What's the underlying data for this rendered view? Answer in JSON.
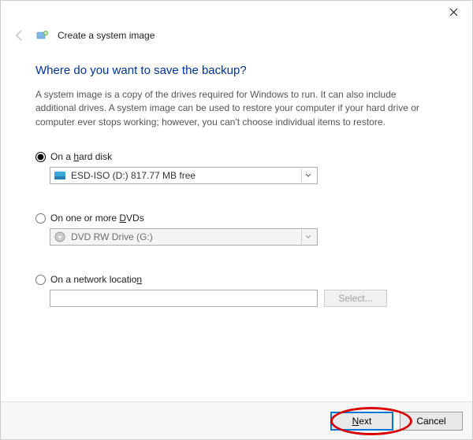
{
  "window": {
    "title": "Create a system image"
  },
  "heading": "Where do you want to save the backup?",
  "description": "A system image is a copy of the drives required for Windows to run. It can also include additional drives. A system image can be used to restore your computer if your hard drive or computer ever stops working; however, you can't choose individual items to restore.",
  "options": {
    "hard_disk": {
      "label_pre": "On a ",
      "label_u": "h",
      "label_post": "ard disk",
      "drive": "ESD-ISO (D:)  817.77 MB free"
    },
    "dvds": {
      "label_pre": "On one or more ",
      "label_u": "D",
      "label_post": "VDs",
      "drive": "DVD RW Drive (G:)"
    },
    "network": {
      "label_pre": "On a network locatio",
      "label_u": "n",
      "label_post": "",
      "value": "",
      "select_btn": "Select..."
    }
  },
  "footer": {
    "next_u": "N",
    "next_post": "ext",
    "cancel": "Cancel"
  }
}
